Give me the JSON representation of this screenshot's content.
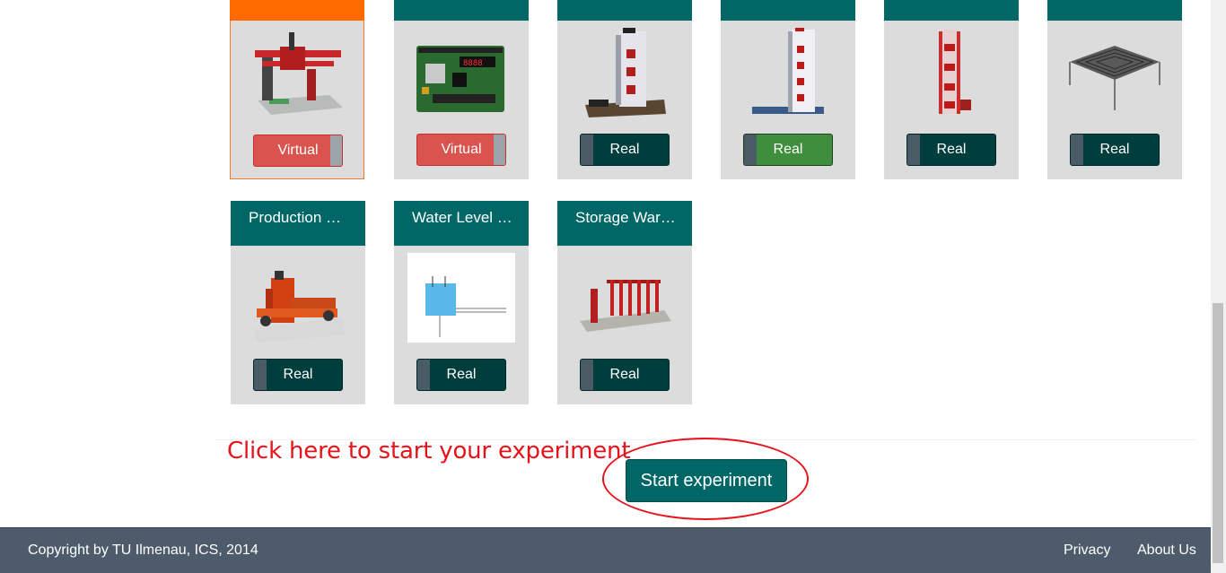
{
  "cards_row1": [
    {
      "title": "",
      "toggle": "Virtual",
      "mode": "virtual",
      "selected": true,
      "image": "xy-plotter-icon"
    },
    {
      "title": "",
      "toggle": "Virtual",
      "mode": "virtual",
      "selected": false,
      "image": "circuit-board-icon"
    },
    {
      "title": "",
      "toggle": "Real",
      "mode": "real",
      "selected": false,
      "image": "elevator-tower-icon"
    },
    {
      "title": "",
      "toggle": "Real",
      "mode": "active-real",
      "selected": false,
      "image": "elevator-tower-icon"
    },
    {
      "title": "",
      "toggle": "Real",
      "mode": "real",
      "selected": false,
      "image": "elevator-tower-small-icon"
    },
    {
      "title": "",
      "toggle": "Real",
      "mode": "real",
      "selected": false,
      "image": "maze-table-icon"
    }
  ],
  "cards_row2": [
    {
      "title": "Production …",
      "toggle": "Real",
      "mode": "real",
      "image": "production-line-icon"
    },
    {
      "title": "Water Level …",
      "toggle": "Real",
      "mode": "real",
      "image": "water-tank-icon"
    },
    {
      "title": "Storage War…",
      "toggle": "Real",
      "mode": "real",
      "image": "storage-rack-icon"
    }
  ],
  "hint_text": "Click here to start your experiment",
  "start_button": "Start experiment",
  "footer": {
    "copyright": "Copyright by TU Ilmenau, ICS, 2014",
    "privacy": "Privacy",
    "about": "About Us"
  },
  "colors": {
    "teal": "#006666",
    "orange": "#ff6a00",
    "virtual_red": "#d9534f",
    "real_dark": "#003e3e",
    "active_green": "#3e8e3e",
    "footer_bg": "#4e5b6b",
    "annotation_red": "#e8121a"
  }
}
